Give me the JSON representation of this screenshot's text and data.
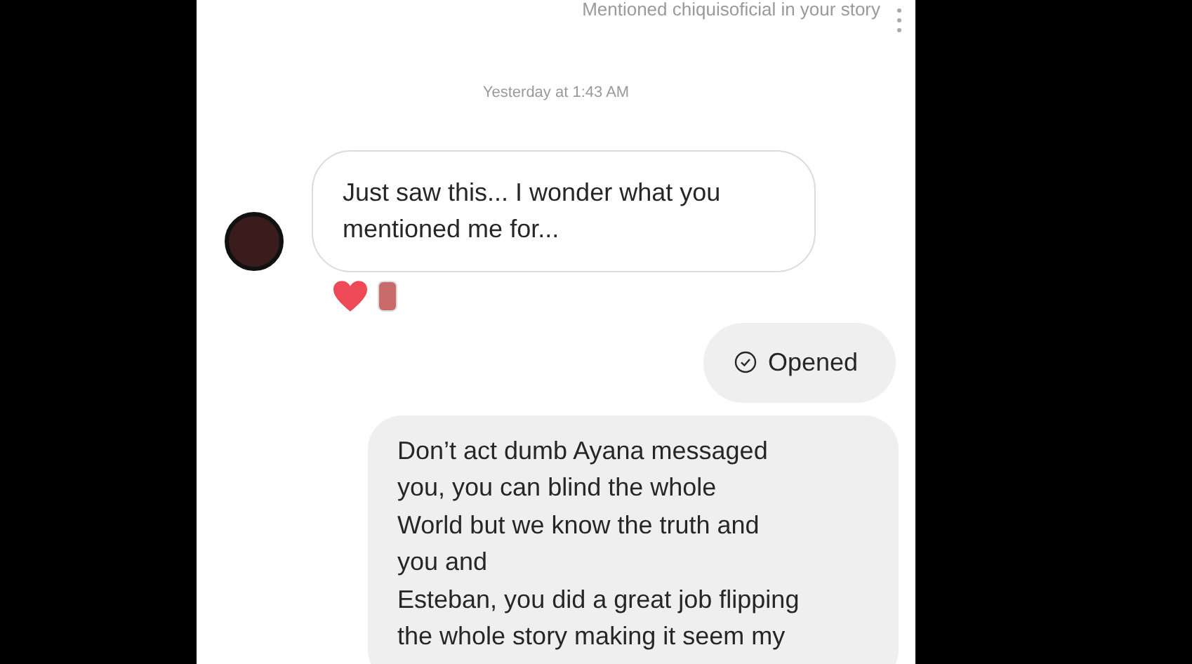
{
  "header": {
    "notice": "Mentioned chiquisoficial in your story"
  },
  "timestamp": "Yesterday at 1:43 AM",
  "messages": [
    {
      "kind": "received",
      "text": "Just saw this... I wonder what you mentioned me for...",
      "reactions": true
    },
    {
      "kind": "status",
      "text": "Opened"
    },
    {
      "kind": "sent",
      "text": "Don’t act dumb Ayana messaged\nyou, you can blind the whole\nWorld but we know the truth and\nyou and\nEsteban, you did a great job flipping\nthe whole story making it seem my"
    }
  ]
}
